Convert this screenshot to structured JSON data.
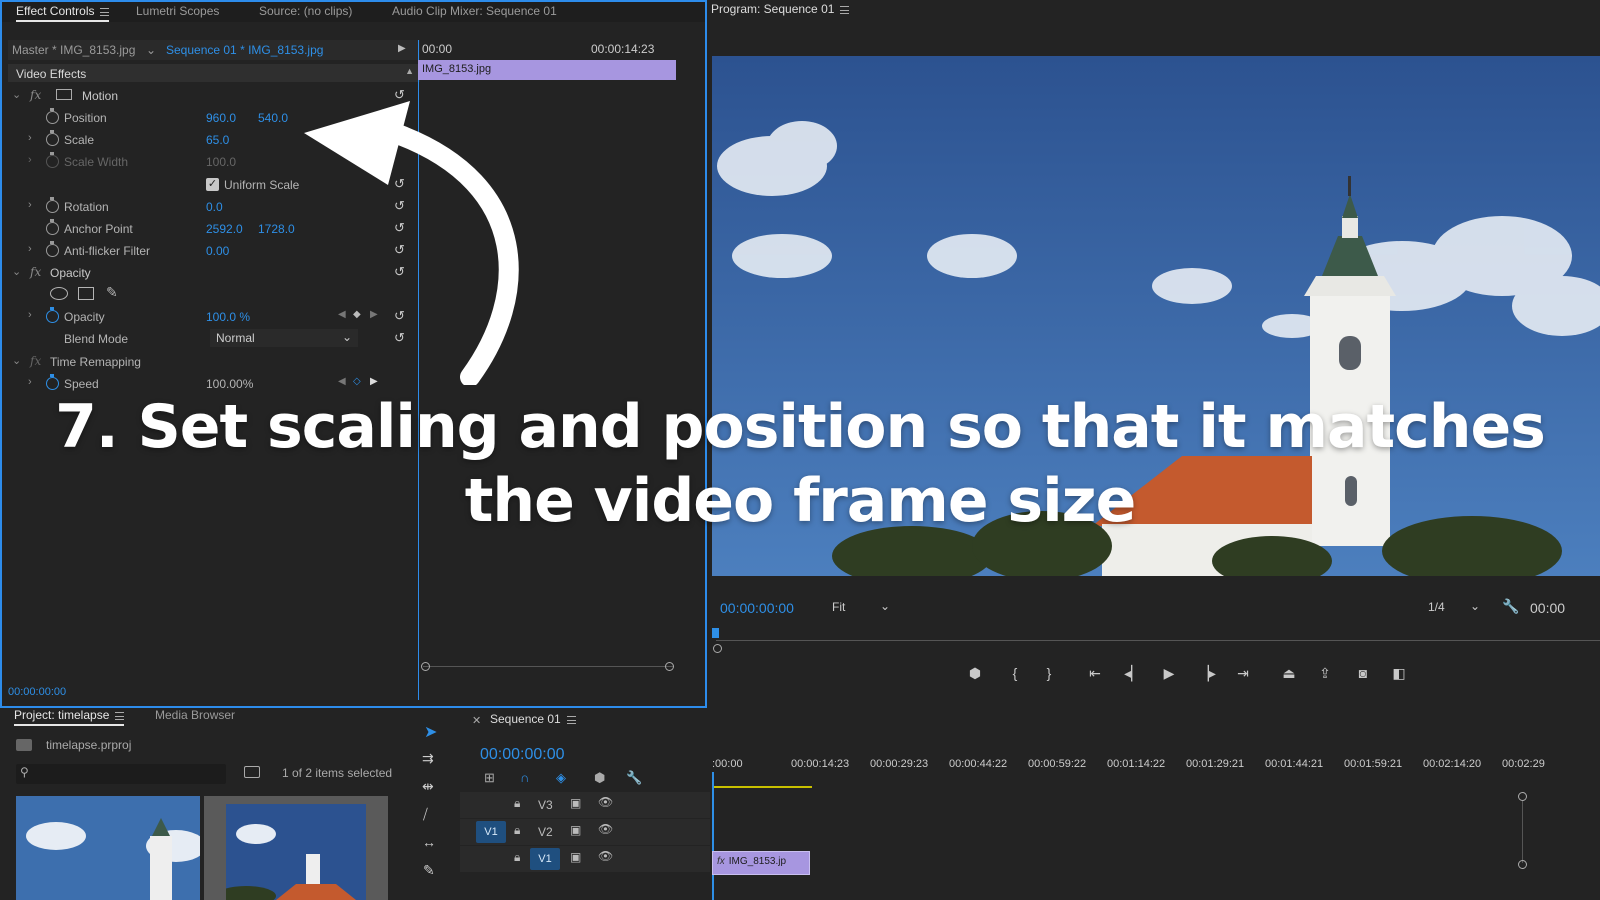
{
  "effect_controls_panel": {
    "tabs": [
      "Effect Controls",
      "Lumetri Scopes",
      "Source: (no clips)",
      "Audio Clip Mixer: Sequence 01"
    ],
    "master_label": "Master * IMG_8153.jpg",
    "sequence_label": "Sequence 01 * IMG_8153.jpg",
    "timeline_start": "00:00",
    "timeline_end": "00:00:14:23",
    "clip_name": "IMG_8153.jpg",
    "section_title": "Video Effects",
    "motion_label": "Motion",
    "position_label": "Position",
    "position_x": "960.0",
    "position_y": "540.0",
    "scale_label": "Scale",
    "scale_value": "65.0",
    "scale_width_label": "Scale Width",
    "scale_width_value": "100.0",
    "uniform_scale_label": "Uniform Scale",
    "rotation_label": "Rotation",
    "rotation_value": "0.0",
    "anchor_label": "Anchor Point",
    "anchor_x": "2592.0",
    "anchor_y": "1728.0",
    "antiflicker_label": "Anti-flicker Filter",
    "antiflicker_value": "0.00",
    "opacity_section": "Opacity",
    "opacity_label": "Opacity",
    "opacity_value": "100.0 %",
    "blend_mode_label": "Blend Mode",
    "blend_mode_value": "Normal",
    "time_remap_label": "Time Remapping",
    "speed_label": "Speed",
    "speed_value": "100.00%",
    "footer_timecode": "00:00:00:00"
  },
  "program_monitor": {
    "title": "Program: Sequence 01",
    "timecode": "00:00:00:00",
    "fit_value": "Fit",
    "resolution_value": "1/4",
    "timecode_right": "00:00"
  },
  "project_panel": {
    "tab": "Project: timelapse",
    "tab2": "Media Browser",
    "project_file": "timelapse.prproj",
    "items_selected": "1 of 2 items selected"
  },
  "sequence_panel": {
    "tab": "Sequence 01",
    "timecode": "00:00:00:00",
    "ruler": [
      ":00:00",
      "00:00:14:23",
      "00:00:29:23",
      "00:00:44:22",
      "00:00:59:22",
      "00:01:14:22",
      "00:01:29:21",
      "00:01:44:21",
      "00:01:59:21",
      "00:02:14:20",
      "00:02:29"
    ],
    "tracks": [
      "V3",
      "V2",
      "V1"
    ],
    "source_patch": "V1",
    "clip_name": "IMG_8153.jp"
  },
  "overlay": {
    "line1": "7. Set scaling and position so that it matches",
    "line2": "the video frame size"
  }
}
